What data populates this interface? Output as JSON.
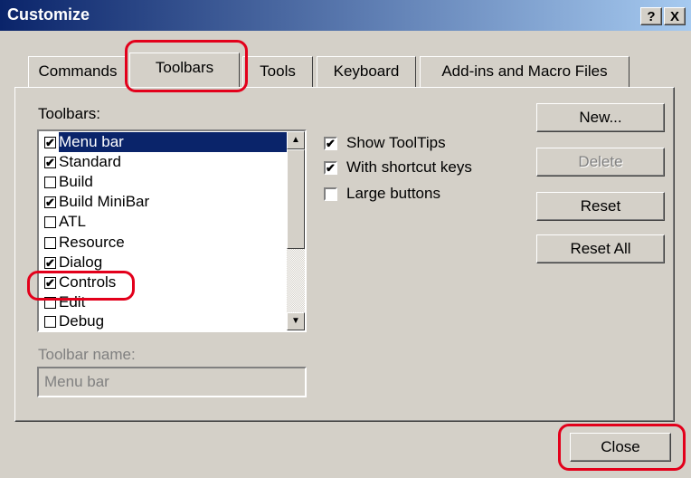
{
  "window": {
    "title": "Customize",
    "help_glyph": "?",
    "close_glyph": "X"
  },
  "tabs": [
    {
      "label": "Commands"
    },
    {
      "label": "Toolbars"
    },
    {
      "label": "Tools"
    },
    {
      "label": "Keyboard"
    },
    {
      "label": "Add-ins and Macro Files"
    }
  ],
  "toolbars_label": "Toolbars:",
  "toolbars": [
    {
      "label": "Menu bar",
      "checked": true,
      "selected": true
    },
    {
      "label": "Standard",
      "checked": true
    },
    {
      "label": "Build",
      "checked": false
    },
    {
      "label": "Build MiniBar",
      "checked": true
    },
    {
      "label": "ATL",
      "checked": false
    },
    {
      "label": "Resource",
      "checked": false
    },
    {
      "label": "Dialog",
      "checked": true
    },
    {
      "label": "Controls",
      "checked": true
    },
    {
      "label": "Edit",
      "checked": false
    },
    {
      "label": "Debug",
      "checked": false
    }
  ],
  "options": [
    {
      "label": "Show ToolTips",
      "checked": true
    },
    {
      "label": "With shortcut keys",
      "checked": true
    },
    {
      "label": "Large buttons",
      "checked": false
    }
  ],
  "buttons": {
    "new": "New...",
    "delete": "Delete",
    "reset": "Reset",
    "reset_all": "Reset All",
    "close": "Close"
  },
  "toolbar_name_label": "Toolbar name:",
  "toolbar_name_value": "Menu bar",
  "check_glyph": "✔",
  "scroll_up_glyph": "▲",
  "scroll_down_glyph": "▼",
  "colors": {
    "title_start": "#0a246a",
    "title_end": "#a6caf0",
    "highlight_ring": "#e3001b",
    "selection": "#0a246a",
    "face": "#d4d0c8"
  }
}
